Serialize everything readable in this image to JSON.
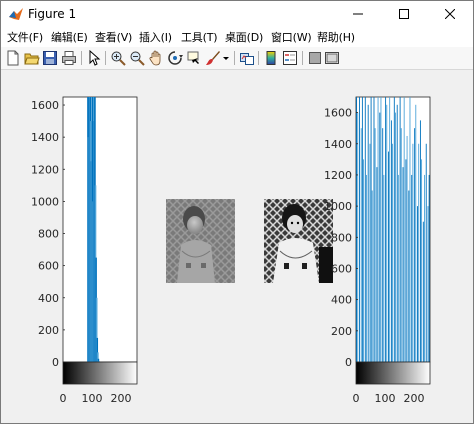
{
  "window": {
    "title": "Figure 1"
  },
  "menu": [
    {
      "label": "文件(F)"
    },
    {
      "label": "编辑(E)"
    },
    {
      "label": "查看(V)"
    },
    {
      "label": "插入(I)"
    },
    {
      "label": "工具(T)"
    },
    {
      "label": "桌面(D)"
    },
    {
      "label": "窗口(W)"
    },
    {
      "label": "帮助(H)"
    }
  ],
  "toolbar": {
    "icons": [
      "new-figure-icon",
      "open-file-icon",
      "save-icon",
      "print-icon",
      "pointer-icon",
      "zoom-in-icon",
      "zoom-out-icon",
      "pan-icon",
      "rotate-3d-icon",
      "data-cursor-icon",
      "brush-icon",
      "link-plot-icon",
      "colorbar-icon",
      "legend-icon",
      "hide-plot-tools-icon",
      "show-plot-tools-icon"
    ]
  },
  "colors": {
    "bar": "#0072bd",
    "bar_light": "#4da3d8"
  },
  "chart_data": [
    {
      "type": "bar",
      "title": "",
      "xlabel": "",
      "ylabel": "",
      "xlim": [
        0,
        255
      ],
      "ylim": [
        0,
        1650
      ],
      "yticks": [
        "0",
        "200",
        "400",
        "600",
        "800",
        "1000",
        "1200",
        "1400",
        "1600"
      ],
      "xticks": [
        "0",
        "100",
        "200"
      ],
      "series": [
        {
          "x": [
            86,
            88,
            90,
            92,
            94,
            96,
            98,
            100,
            102,
            104,
            106,
            108,
            110,
            112,
            114,
            116,
            118,
            120,
            122,
            124
          ],
          "values": [
            1650,
            1400,
            1650,
            1650,
            1650,
            1500,
            1250,
            1650,
            1650,
            1000,
            1500,
            1650,
            1650,
            1100,
            650,
            400,
            150,
            60,
            20,
            5
          ]
        }
      ]
    },
    {
      "type": "image",
      "description": "original grayscale photo"
    },
    {
      "type": "image",
      "description": "histogram-equalized grayscale photo"
    },
    {
      "type": "bar",
      "title": "",
      "xlabel": "",
      "ylabel": "",
      "xlim": [
        0,
        255
      ],
      "ylim": [
        0,
        1700
      ],
      "yticks": [
        "0",
        "200",
        "400",
        "600",
        "800",
        "1000",
        "1200",
        "1400",
        "1600"
      ],
      "xticks": [
        "0",
        "100",
        "200"
      ],
      "series": [
        {
          "x": [
            2,
            6,
            12,
            18,
            22,
            26,
            32,
            36,
            42,
            48,
            52,
            56,
            62,
            66,
            72,
            76,
            82,
            86,
            92,
            96,
            102,
            106,
            112,
            116,
            122,
            126,
            132,
            136,
            142,
            146,
            152,
            156,
            162,
            166,
            172,
            176,
            182,
            186,
            192,
            196,
            202,
            206,
            212,
            216,
            222,
            226,
            232,
            236,
            242,
            248,
            252
          ],
          "values": [
            1700,
            1600,
            1700,
            1500,
            1700,
            1300,
            1700,
            1200,
            1650,
            1400,
            1700,
            1100,
            1700,
            1500,
            1250,
            1700,
            1600,
            1700,
            1500,
            1200,
            1700,
            1650,
            1350,
            1700,
            1550,
            1400,
            1700,
            1600,
            1650,
            1200,
            1700,
            1500,
            1250,
            1700,
            1300,
            1450,
            1100,
            1700,
            1200,
            1400,
            1500,
            1650,
            1000,
            1400,
            1550,
            1300,
            900,
            1200,
            1400,
            1000,
            1200
          ]
        }
      ]
    }
  ]
}
